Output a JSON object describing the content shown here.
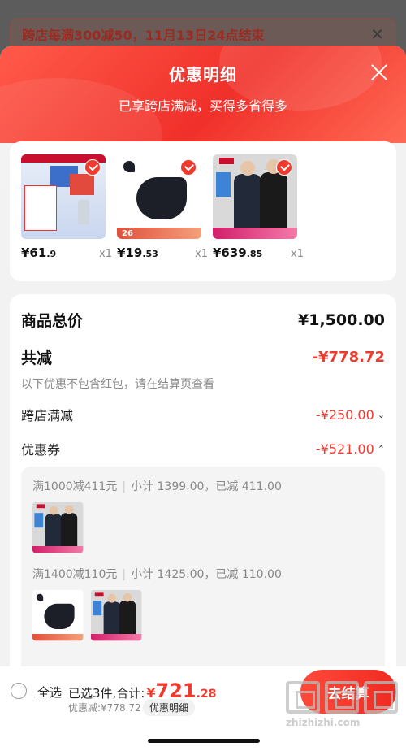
{
  "background_banner": {
    "text": "跨店每满300减50，11月13日24点结束",
    "close_icon": "close-icon"
  },
  "sheet": {
    "title": "优惠明细",
    "subtitle": "已享跨店满减，买得多省得多",
    "close_icon": "close-icon"
  },
  "products": [
    {
      "price_int": "¥61",
      "price_dec": ".9",
      "qty": "x1",
      "selected": true
    },
    {
      "price_int": "¥19",
      "price_dec": ".53",
      "qty": "x1",
      "selected": true,
      "tag": "26"
    },
    {
      "price_int": "¥639",
      "price_dec": ".85",
      "qty": "x1",
      "selected": true
    }
  ],
  "summary": {
    "total_label": "商品总价",
    "total_value": "¥1,500.00",
    "reduce_label": "共减",
    "reduce_value": "-¥778.72",
    "note": "以下优惠不包含红包，请在结算页查看",
    "crossstore_label": "跨店满减",
    "crossstore_value": "-¥250.00",
    "coupon_label": "优惠券",
    "coupon_value": "-¥521.00",
    "coupons": [
      {
        "rule": "满1000减411元",
        "subtotal": "小计 1399.00，已减 411.00"
      },
      {
        "rule": "满1400减110元",
        "subtotal": "小计 1425.00，已减 110.00"
      }
    ]
  },
  "bottom_bar": {
    "select_all": "全选",
    "selected_prefix": "已选3件,合计:",
    "currency": "¥",
    "total_int": "721",
    "total_dec": ".28",
    "discount_text": "优惠减:¥778.72",
    "detail_label": "优惠明细",
    "checkout_label": "去结算"
  },
  "watermark": {
    "url": "zhizhizhi.com"
  },
  "colors": {
    "accent": "#f03a2e",
    "header_gradient_start": "#ff5a4a"
  }
}
